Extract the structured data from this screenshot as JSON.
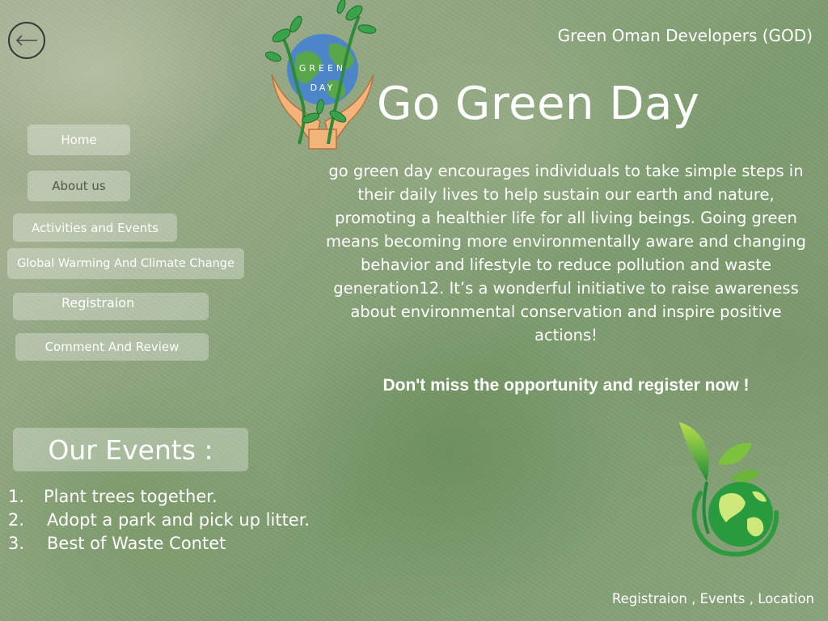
{
  "header": {
    "brand": "Green Oman Developers (GOD)",
    "back_icon": "back-arrow-icon"
  },
  "logo_top": {
    "icon": "green-day-globe-hands-logo",
    "text": "GREEN DAY",
    "colors": {
      "leaf": "#2f8a3a",
      "ocean": "#4d86c8",
      "hands": "#f2b47a"
    }
  },
  "nav": {
    "home": "Home",
    "about": "About us",
    "activities": "Activities and Events",
    "global_warming": "Global Warming And Climate Change",
    "registration": "Registraion",
    "comment": "Comment And Review"
  },
  "hero": {
    "title": "Go Green Day",
    "description": "go green day encourages individuals to take simple steps in their daily lives to help sustain our earth and nature, promoting a healthier life for all living beings. Going green means becoming more environmentally aware and changing behavior and lifestyle to reduce pollution and waste generation12. It’s a wonderful initiative to raise awareness about environmental conservation and inspire positive actions!",
    "cta": "Don't miss the opportunity and register now !"
  },
  "events": {
    "heading": "Our Events :",
    "items": [
      {
        "num": "1.",
        "label": "Plant trees together."
      },
      {
        "num": "2.",
        "label": "Adopt a park and pick up litter."
      },
      {
        "num": "3.",
        "label": "Best of Waste Contet"
      }
    ]
  },
  "logo_bottom": {
    "icon": "eco-globe-leaf-logo",
    "colors": {
      "light": "#9cd23a",
      "dark": "#1f8a3a"
    }
  },
  "footer": {
    "links": "Registraion , Events , Location"
  }
}
